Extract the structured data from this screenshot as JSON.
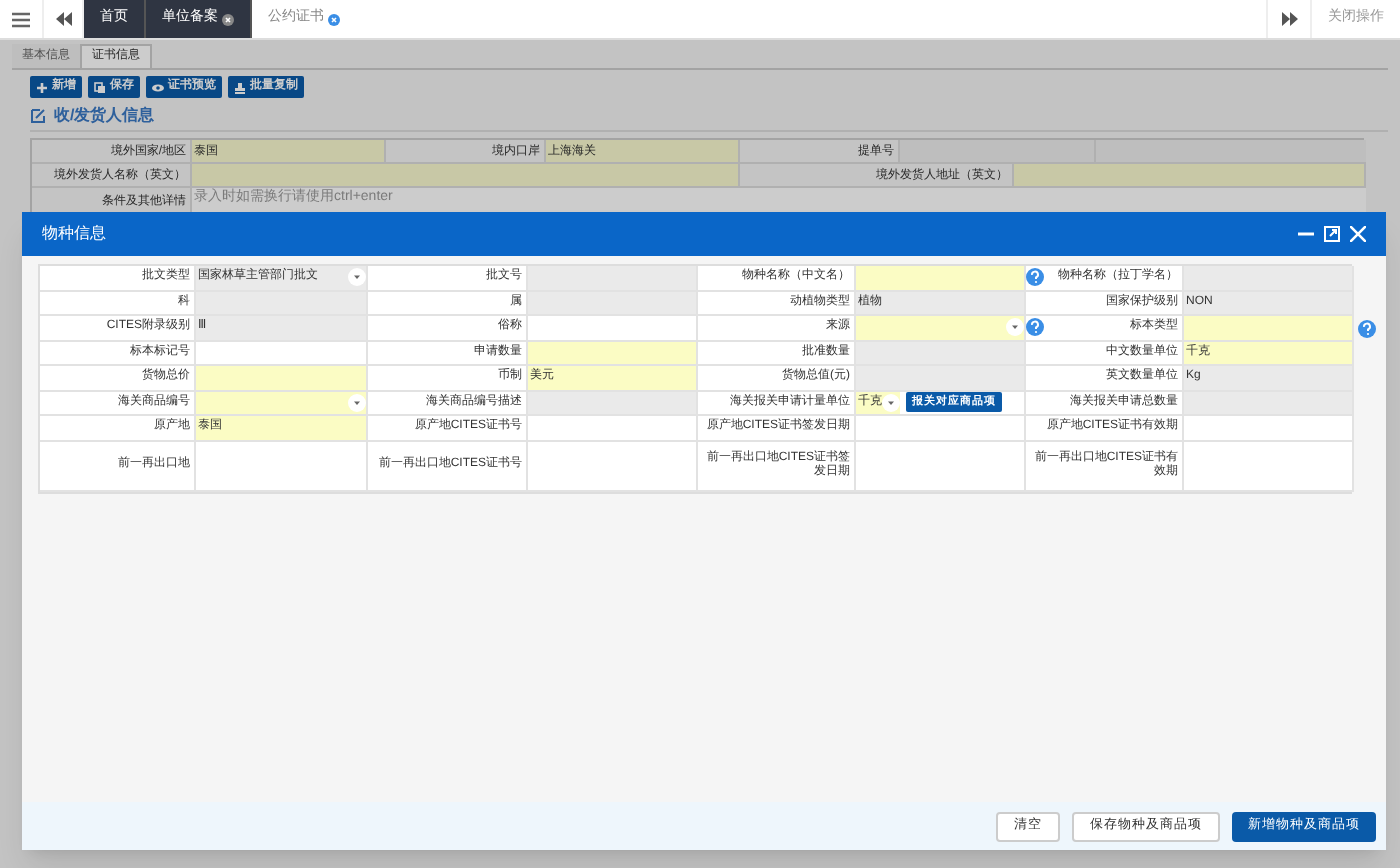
{
  "top_tabs": [
    {
      "label": "首页",
      "selected": false,
      "closable": false
    },
    {
      "label": "单位备案",
      "selected": false,
      "closable": true
    },
    {
      "label": "公约证书",
      "selected": true,
      "closable": true
    }
  ],
  "close_ops": "关闭操作",
  "sub_tabs": [
    {
      "label": "基本信息",
      "selected": false
    },
    {
      "label": "证书信息",
      "selected": true
    }
  ],
  "toolbar": [
    {
      "label": "新增",
      "kind": "plus"
    },
    {
      "label": "保存",
      "kind": "copy"
    },
    {
      "label": "证书预览",
      "kind": "eye"
    },
    {
      "label": "批量复制",
      "kind": "stamp"
    }
  ],
  "section_title": "收/发货人信息",
  "consignor_form": {
    "row_1": [
      {
        "label": "境外国家/地区",
        "value": "泰国"
      },
      {
        "label": "境内口岸",
        "value": "上海海关"
      },
      {
        "label": "提单号"
      }
    ],
    "row_2": [
      {
        "label": "境外发货人名称（英文）"
      },
      {
        "label": "境外发货人地址（英文）"
      }
    ],
    "row_3": {
      "label": "条件及其他详情",
      "placeholder": "录入时如需换行请使用ctrl+enter"
    }
  },
  "dialog": {
    "title": "物种信息",
    "rows": [
      [
        {
          "label": "批文类型",
          "value": "国家林草主管部门批文",
          "kind": "readonly",
          "dropdown": true
        },
        {
          "label": "批文号",
          "kind": "readonly"
        },
        {
          "label": "物种名称（中文名）",
          "kind": "required"
        },
        {
          "label": "物种名称（拉丁学名）",
          "kind": "readonly",
          "help": true
        }
      ],
      [
        {
          "label": "科",
          "kind": "readonly"
        },
        {
          "label": "属",
          "kind": "readonly"
        },
        {
          "label": "动植物类型",
          "value": "植物",
          "kind": "readonly"
        },
        {
          "label": "国家保护级别",
          "value": "NON",
          "kind": "readonly"
        }
      ],
      [
        {
          "label": "CITES附录级别",
          "value": "Ⅲ",
          "kind": "readonly"
        },
        {
          "label": "俗称",
          "kind": "plain"
        },
        {
          "label": "来源",
          "kind": "required",
          "dropdown": true
        },
        {
          "label": "标本类型",
          "kind": "required",
          "help": true,
          "trailing_help": true
        }
      ],
      [
        {
          "label": "标本标记号",
          "kind": "plain"
        },
        {
          "label": "申请数量",
          "kind": "required"
        },
        {
          "label": "批准数量",
          "kind": "readonly"
        },
        {
          "label": "中文数量单位",
          "value": "千克",
          "kind": "required"
        }
      ],
      [
        {
          "label": "货物总价",
          "kind": "required"
        },
        {
          "label": "币制",
          "value": "美元",
          "kind": "required"
        },
        {
          "label": "货物总值(元)",
          "kind": "readonly"
        },
        {
          "label": "英文数量单位",
          "value": "Kg",
          "kind": "readonly"
        }
      ],
      [
        {
          "label": "海关商品编号",
          "kind": "required",
          "dropdown": true
        },
        {
          "label": "海关商品编号描述",
          "kind": "readonly"
        },
        {
          "label": "海关报关申请计量单位",
          "value": "千克",
          "kind": "required",
          "dropdown": true,
          "button": "报关对应商品项"
        },
        {
          "label": "海关报关申请总数量",
          "kind": "readonly"
        }
      ],
      [
        {
          "label": "原产地",
          "value": "泰国",
          "kind": "required"
        },
        {
          "label": "原产地CITES证书号",
          "kind": "plain"
        },
        {
          "label": "原产地CITES证书签发日期",
          "kind": "plain"
        },
        {
          "label": "原产地CITES证书有效期",
          "kind": "plain"
        }
      ],
      [
        {
          "label": "前一再出口地",
          "kind": "plain"
        },
        {
          "label": "前一再出口地CITES证书号",
          "kind": "plain"
        },
        {
          "label": "前一再出口地CITES证书签发日期",
          "kind": "plain"
        },
        {
          "label": "前一再出口地CITES证书有效期",
          "kind": "plain"
        }
      ]
    ],
    "buttons": [
      {
        "label": "清空",
        "kind": "secondary"
      },
      {
        "label": "保存物种及商品项",
        "kind": "secondary"
      },
      {
        "label": "新增物种及商品项",
        "kind": "primary"
      }
    ]
  }
}
